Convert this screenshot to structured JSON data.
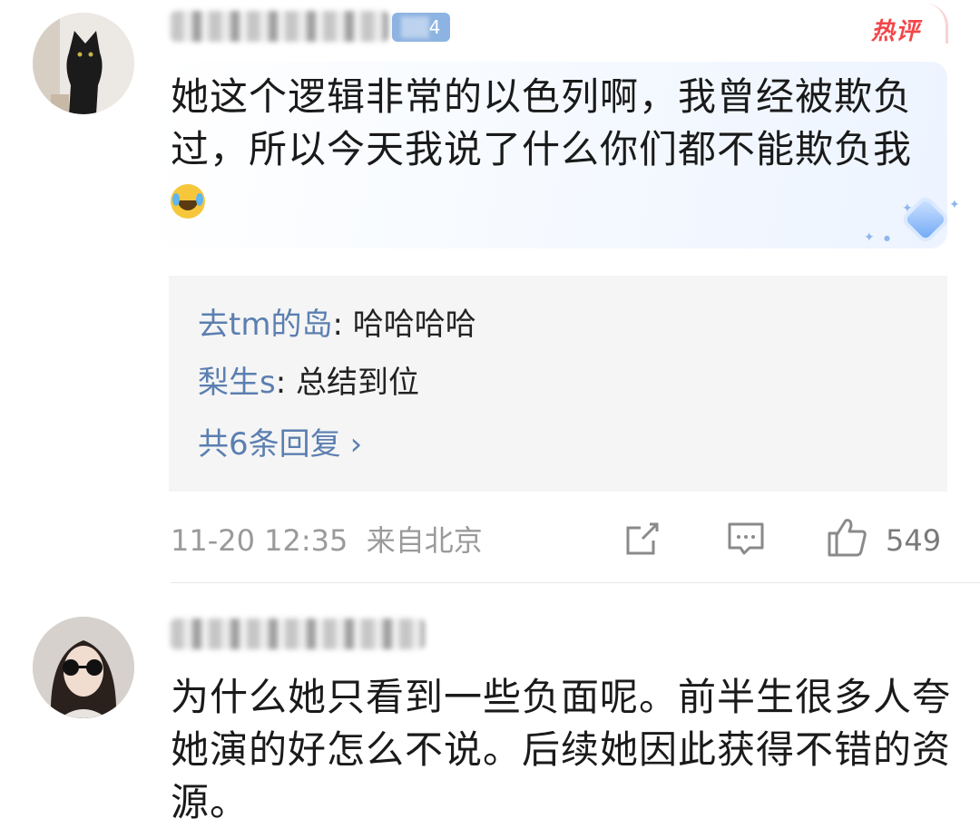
{
  "comment1": {
    "username": "",
    "fan_badge": "4",
    "hot_label": "热评",
    "text": "她这个逻辑非常的以色列啊，我曾经被欺负过，所以今天我说了什么你们都不能欺负我",
    "replies": [
      {
        "name": "去tm的岛",
        "sep": ": ",
        "text": "哈哈哈哈"
      },
      {
        "name": "梨生s",
        "sep": ": ",
        "text": "总结到位"
      }
    ],
    "more_replies": "共6条回复",
    "more_chevron": "›",
    "timestamp": "11-20 12:35",
    "location": "来自北京",
    "like_count": "549"
  },
  "comment2": {
    "text": "为什么她只看到一些负面呢。前半生很多人夸她演的好怎么不说。后续她因此获得不错的资源。"
  },
  "colors": {
    "link_blue": "#5b7fb0",
    "hot_red": "#f2474a",
    "meta_gray": "#9a9a9a"
  }
}
